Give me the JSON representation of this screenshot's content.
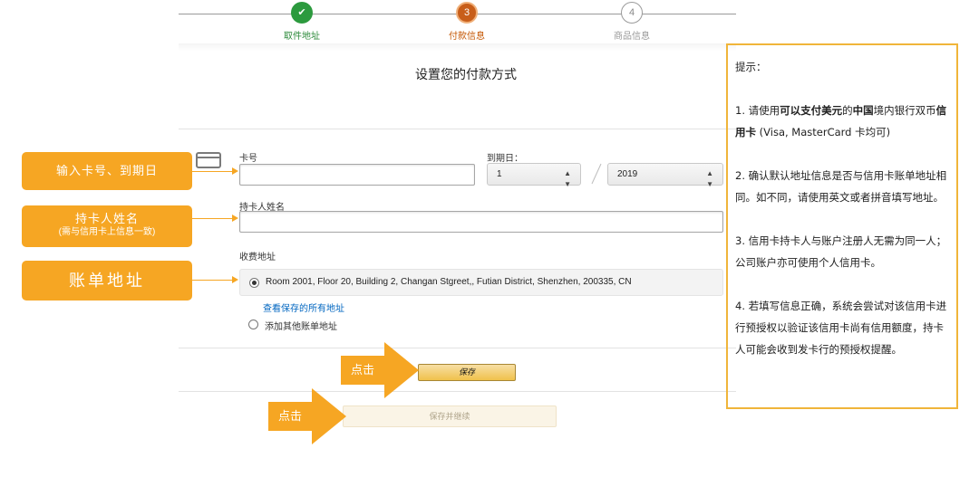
{
  "steps": [
    {
      "label": "取件地址",
      "marker": "✔",
      "state": "done"
    },
    {
      "label": "付款信息",
      "marker": "3",
      "state": "current"
    },
    {
      "label": "商品信息",
      "marker": "4",
      "state": "todo"
    }
  ],
  "page_title": "设置您的付款方式",
  "form": {
    "card_number_label": "卡号",
    "expiry_label": "到期日：",
    "expiry_month": "1",
    "expiry_year": "2019",
    "cardholder_label": "持卡人姓名",
    "billing_label": "收费地址",
    "address": "Room 2001, Floor 20, Building 2, Changan Stgreet,, Futian District, Shenzhen, 200335, CN",
    "view_saved_link": "查看保存的所有地址",
    "add_other_address": "添加其他账单地址",
    "save_button": "保存",
    "save_continue_button": "保存并继续"
  },
  "callouts": {
    "card_expiry": "输入卡号、到期日",
    "cardholder_main": "持卡人姓名",
    "cardholder_sub": "(需与信用卡上信息一致)",
    "billing_address": "账单地址",
    "click_1": "点击",
    "click_2": "点击"
  },
  "hint": {
    "title": "提示：",
    "item1": {
      "p1": "1. 请使用",
      "b1": "可以支付美元",
      "p2": "的",
      "b2": "中国",
      "p3": "境内银行双币",
      "b3": "信用卡",
      "p4": " (Visa, MasterCard 卡均可)"
    },
    "item2": "2. 确认默认地址信息是否与信用卡账单地址相同。如不同，请使用英文或者拼音填写地址。",
    "item3": "3. 信用卡持卡人与账户注册人无需为同一人；公司账户亦可使用个人信用卡。",
    "item4": "4. 若填写信息正确，系统会尝试对该信用卡进行预授权以验证该信用卡尚有信用额度，持卡人可能会收到发卡行的预授权提醒。"
  },
  "colors": {
    "callout_orange": "#f6a623",
    "step_done_green": "#2c9a3e",
    "step_current_orange": "#c85e1a",
    "link_blue": "#0066c0",
    "hint_border": "#f0b53a"
  }
}
